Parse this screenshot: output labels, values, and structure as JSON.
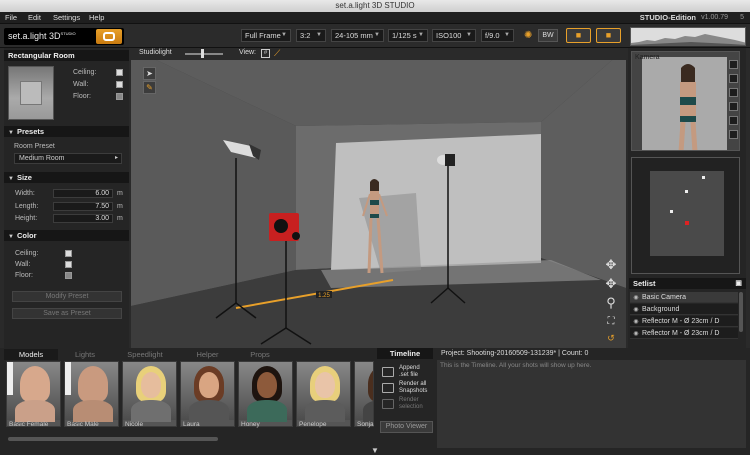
{
  "window": {
    "title": "set.a.light 3D STUDIO"
  },
  "menu": {
    "items": [
      "File",
      "Edit",
      "Settings",
      "Help"
    ],
    "edition": "STUDIO-Edition",
    "version": "v1.00.79"
  },
  "logo": {
    "text": "set.a.light 3D",
    "sup": "STUDIO"
  },
  "toolbar": {
    "sensor": "Full Frame",
    "ratio": "3:2",
    "lens": "24-105 mm",
    "shutter": "1/125 s",
    "iso": "ISO100",
    "aperture": "f/9.0",
    "bw_label": "BW",
    "version_tail": "5"
  },
  "left_panel": {
    "room_title": "Rectangular Room",
    "room_color_labels": {
      "ceiling": "Ceiling:",
      "wall": "Wall:",
      "floor": "Floor:"
    },
    "presets": {
      "title": "Presets",
      "room_preset_label": "Room Preset",
      "selected": "Medium Room"
    },
    "size": {
      "title": "Size",
      "width_label": "Width:",
      "width": "6.00",
      "length_label": "Length:",
      "length": "7.50",
      "height_label": "Height:",
      "height": "3.00",
      "unit": "m"
    },
    "color": {
      "title": "Color",
      "ceiling": "Ceiling:",
      "wall": "Wall:",
      "floor": "Floor:"
    },
    "modify_preset": "Modify Preset",
    "save_preset": "Save as Preset"
  },
  "viewport": {
    "mode": "Studiolight",
    "view_label": "View:",
    "distance": "1.25"
  },
  "camera_panel": {
    "label": "Kamera"
  },
  "setlist": {
    "title": "Setlist",
    "items": [
      {
        "label": "Basic Camera",
        "selected": true
      },
      {
        "label": "Background",
        "selected": false
      },
      {
        "label": "Reflector M - Ø 23cm / D",
        "selected": false
      },
      {
        "label": "Reflector M - Ø 23cm / D",
        "selected": false
      }
    ]
  },
  "bottom_tabs": [
    "Models",
    "Lights",
    "Speedlight",
    "Helper",
    "Props"
  ],
  "models": [
    {
      "name": "Basic Female",
      "animated": true,
      "skin": "#d7a88c",
      "hair": "#d7a88c",
      "body": "#caa089"
    },
    {
      "name": "Basic Male",
      "animated": true,
      "skin": "#c99a7f",
      "hair": "#c99a7f",
      "body": "#b88d74"
    },
    {
      "name": "Nicole",
      "animated": false,
      "skin": "#e6bd9d",
      "hair": "#e8d07a",
      "body": "#6f6f6f"
    },
    {
      "name": "Laura",
      "animated": false,
      "skin": "#d9a582",
      "hair": "#6b3c25",
      "body": "#555555"
    },
    {
      "name": "Honey",
      "animated": false,
      "skin": "#8d5a3b",
      "hair": "#1e140f",
      "body": "#3c6a5a"
    },
    {
      "name": "Penelope",
      "animated": false,
      "skin": "#e9c4a8",
      "hair": "#e8cf7c",
      "body": "#5c5c5c"
    },
    {
      "name": "Sonja",
      "animated": false,
      "skin": "#d9a98a",
      "hair": "#4a2e1e",
      "body": "#444444"
    }
  ],
  "timeline": {
    "tab": "Timeline",
    "project": "Project: Shooting-20160509-131239*  |  Count: 0",
    "hint": "This is the Timeline. All your shots will show up here.",
    "append": [
      "Append",
      ".set file"
    ],
    "render_all": [
      "Render all",
      "Snapshots"
    ],
    "render_sel": [
      "Render",
      "selection"
    ],
    "photo_viewer": "Photo Viewer"
  }
}
